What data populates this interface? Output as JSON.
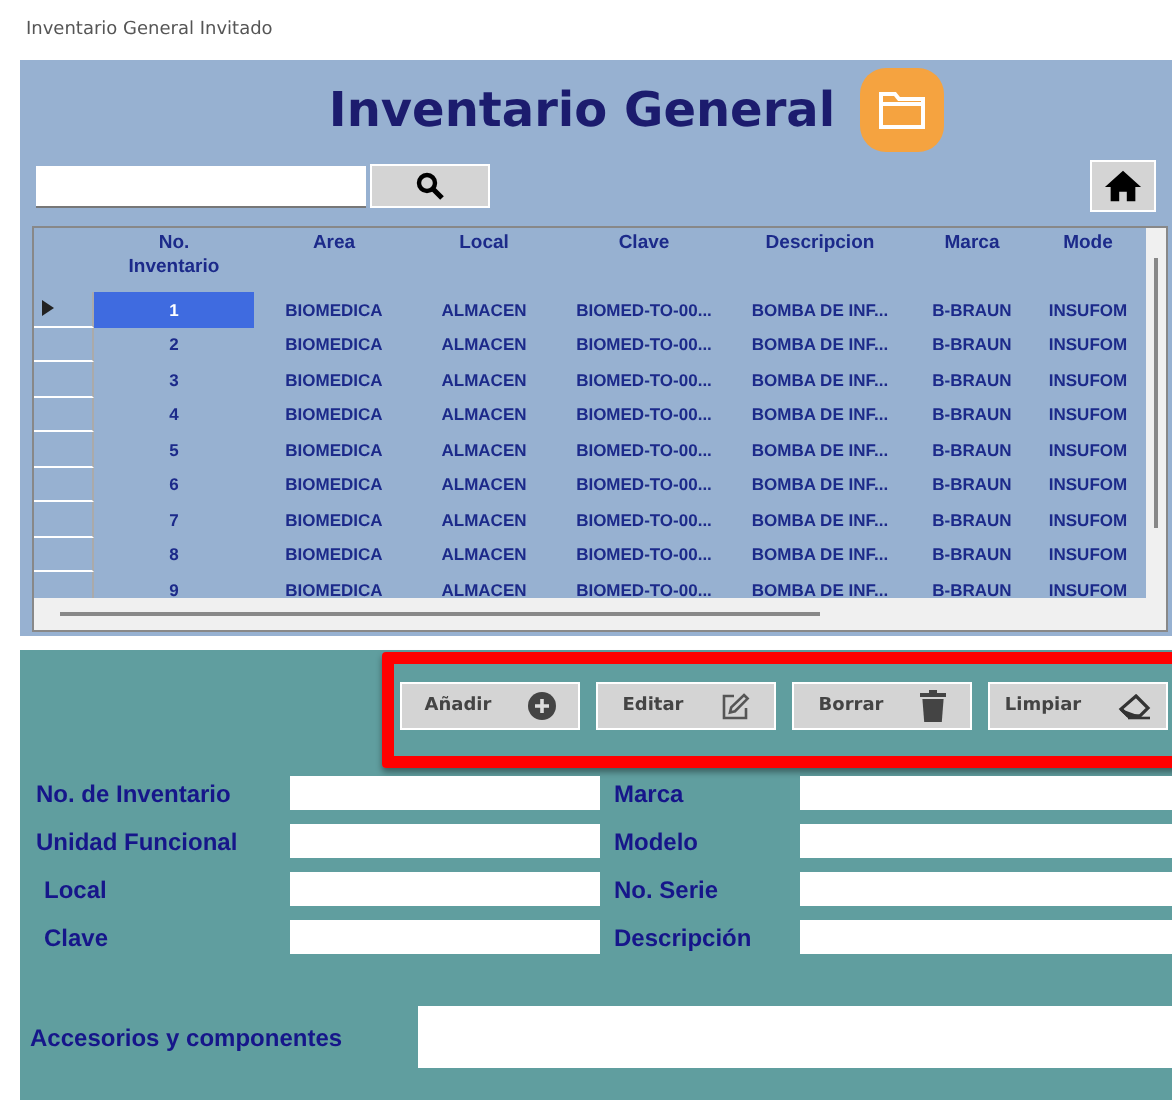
{
  "window": {
    "title": "Inventario General Invitado"
  },
  "header": {
    "title": "Inventario General"
  },
  "table": {
    "columns": [
      "No.\nInventario",
      "Area",
      "Local",
      "Clave",
      "Descripcion",
      "Marca",
      "Mode"
    ],
    "rows": [
      {
        "selected": true,
        "cells": [
          "1",
          "BIOMEDICA",
          "ALMACEN",
          "BIOMED-TO-00...",
          "BOMBA DE INF...",
          "B-BRAUN",
          "INSUFOM"
        ]
      },
      {
        "selected": false,
        "cells": [
          "2",
          "BIOMEDICA",
          "ALMACEN",
          "BIOMED-TO-00...",
          "BOMBA DE INF...",
          "B-BRAUN",
          "INSUFOM"
        ]
      },
      {
        "selected": false,
        "cells": [
          "3",
          "BIOMEDICA",
          "ALMACEN",
          "BIOMED-TO-00...",
          "BOMBA DE INF...",
          "B-BRAUN",
          "INSUFOM"
        ]
      },
      {
        "selected": false,
        "cells": [
          "4",
          "BIOMEDICA",
          "ALMACEN",
          "BIOMED-TO-00...",
          "BOMBA DE INF...",
          "B-BRAUN",
          "INSUFOM"
        ]
      },
      {
        "selected": false,
        "cells": [
          "5",
          "BIOMEDICA",
          "ALMACEN",
          "BIOMED-TO-00...",
          "BOMBA DE INF...",
          "B-BRAUN",
          "INSUFOM"
        ]
      },
      {
        "selected": false,
        "cells": [
          "6",
          "BIOMEDICA",
          "ALMACEN",
          "BIOMED-TO-00...",
          "BOMBA DE INF...",
          "B-BRAUN",
          "INSUFOM"
        ]
      },
      {
        "selected": false,
        "cells": [
          "7",
          "BIOMEDICA",
          "ALMACEN",
          "BIOMED-TO-00...",
          "BOMBA DE INF...",
          "B-BRAUN",
          "INSUFOM"
        ]
      },
      {
        "selected": false,
        "cells": [
          "8",
          "BIOMEDICA",
          "ALMACEN",
          "BIOMED-TO-00...",
          "BOMBA DE INF...",
          "B-BRAUN",
          "INSUFOM"
        ]
      },
      {
        "selected": false,
        "cells": [
          "9",
          "BIOMEDICA",
          "ALMACEN",
          "BIOMED-TO-00...",
          "BOMBA DE INF...",
          "B-BRAUN",
          "INSUFOM"
        ]
      }
    ]
  },
  "buttons": [
    {
      "label": "Añadir",
      "kind": "add"
    },
    {
      "label": "Editar",
      "kind": "edit"
    },
    {
      "label": "Borrar",
      "kind": "delete"
    },
    {
      "label": "Limpiar",
      "kind": "clear"
    }
  ],
  "form": {
    "left": [
      {
        "label": "No. de Inventario"
      },
      {
        "label": "Unidad Funcional"
      },
      {
        "label": "Local"
      },
      {
        "label": "Clave"
      }
    ],
    "right": [
      {
        "label": "Marca"
      },
      {
        "label": "Modelo"
      },
      {
        "label": "No. Serie"
      },
      {
        "label": "Descripción"
      }
    ],
    "wide": {
      "label": "Accesorios y componentes"
    }
  }
}
